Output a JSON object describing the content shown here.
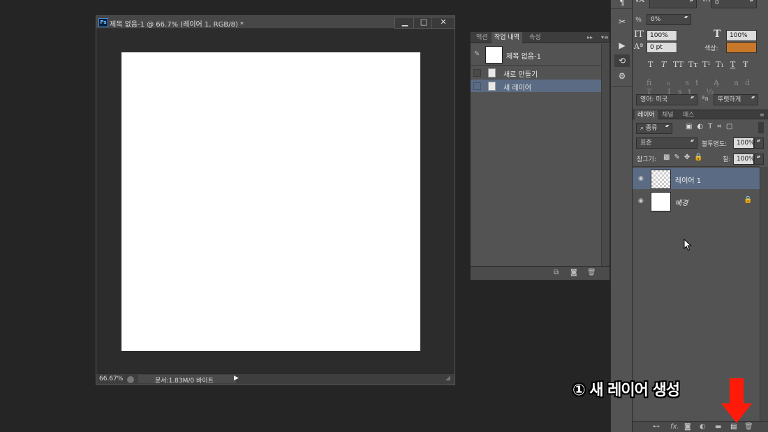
{
  "document_window": {
    "app_icon": "Ps",
    "title": "제목 없음-1 @ 66.7% (레이어 1, RGB/8) *",
    "buttons": {
      "minimize": "▁",
      "maximize": "□",
      "close": "✕"
    },
    "zoom": "66.67%",
    "doc_info": "문서:1.83M/0 바이트"
  },
  "history_panel": {
    "tabs": [
      "액션",
      "작업 내역",
      "속성"
    ],
    "active_tab": "작업 내역",
    "snapshot_label": "제목 없음-1",
    "items": [
      {
        "label": "새로 만들기",
        "selected": false
      },
      {
        "label": "새 레이어",
        "selected": true
      }
    ]
  },
  "character_panel": {
    "tracking_value": "0",
    "kerning_value": "0%",
    "vertical_scale": "100%",
    "horizontal_scale": "100%",
    "baseline_shift": "0 pt",
    "color_label": "색상:",
    "color": "#c8782a",
    "style_buttons": [
      "T",
      "T",
      "TT",
      "Tт",
      "T¹",
      "T₁",
      "T",
      "Ŧ"
    ],
    "language": "영어: 미국",
    "aa_label": "ªa",
    "antialias": "뚜렷하게"
  },
  "layers_panel": {
    "tabs": [
      "레이어",
      "채널",
      "패스"
    ],
    "filter": "종류",
    "blend_mode": "표준",
    "opacity_label": "불투명도:",
    "opacity": "100%",
    "lock_label": "잠그기:",
    "fill_label": "칠:",
    "fill": "100%",
    "layers": [
      {
        "name": "레이어 1",
        "selected": true,
        "transparent": true,
        "locked": false
      },
      {
        "name": "배경",
        "selected": false,
        "transparent": false,
        "locked": true
      }
    ],
    "bottom_icons": [
      "link-icon",
      "fx-icon",
      "mask-icon",
      "adjustment-icon",
      "folder-icon",
      "new-layer-icon",
      "trash-icon"
    ]
  },
  "annotation": {
    "text": "① 새 레이어 생성",
    "arrow_color": "#ff1a0a"
  }
}
